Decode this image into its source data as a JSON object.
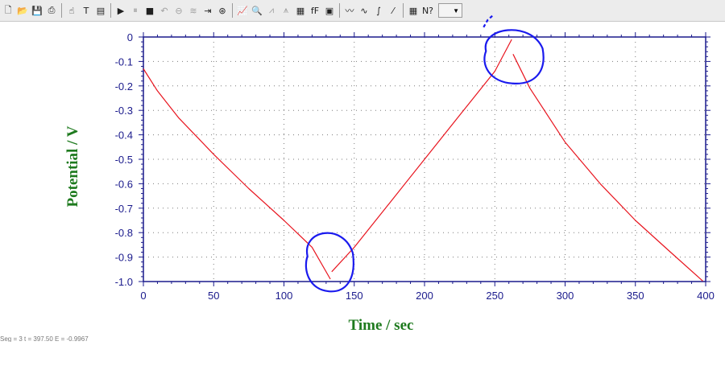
{
  "toolbar": {
    "buttons": [
      {
        "name": "new-file-icon",
        "glyph": "🗋",
        "enabled": true
      },
      {
        "name": "open-folder-icon",
        "glyph": "📂",
        "enabled": true
      },
      {
        "name": "save-icon",
        "glyph": "💾",
        "enabled": true
      },
      {
        "name": "print-icon",
        "glyph": "⎙",
        "enabled": true
      },
      {
        "name": "sep"
      },
      {
        "name": "hand-tool-icon",
        "glyph": "☝",
        "enabled": true
      },
      {
        "name": "text-tool-icon",
        "glyph": "T",
        "enabled": true
      },
      {
        "name": "data-list-icon",
        "glyph": "▤",
        "enabled": true
      },
      {
        "name": "sep"
      },
      {
        "name": "run-icon",
        "glyph": "▶",
        "enabled": true
      },
      {
        "name": "pause-icon",
        "glyph": "⏸",
        "enabled": false
      },
      {
        "name": "stop-icon",
        "glyph": "■",
        "enabled": true
      },
      {
        "name": "reverse-icon",
        "glyph": "↶",
        "enabled": false
      },
      {
        "name": "ir-comp-icon",
        "glyph": "⊖",
        "enabled": false
      },
      {
        "name": "filter-icon",
        "glyph": "≋",
        "enabled": false
      },
      {
        "name": "cell-control-icon",
        "glyph": "⇥",
        "enabled": true
      },
      {
        "name": "rotation-icon",
        "glyph": "⊛",
        "enabled": true
      },
      {
        "name": "sep"
      },
      {
        "name": "graph-options-icon",
        "glyph": "📈",
        "enabled": true
      },
      {
        "name": "zoom-icon",
        "glyph": "🔍",
        "enabled": false
      },
      {
        "name": "peak-icon",
        "glyph": "⩘",
        "enabled": false
      },
      {
        "name": "baseline-icon",
        "glyph": "⩚",
        "enabled": false
      },
      {
        "name": "color-icon",
        "glyph": "▦",
        "enabled": true
      },
      {
        "name": "font-icon",
        "glyph": "fF",
        "enabled": true
      },
      {
        "name": "copy-graph-icon",
        "glyph": "▣",
        "enabled": true
      },
      {
        "name": "sep"
      },
      {
        "name": "smooth-icon",
        "glyph": "〰",
        "enabled": true
      },
      {
        "name": "derivative-icon",
        "glyph": "∿",
        "enabled": true
      },
      {
        "name": "integrate-icon",
        "glyph": "∫",
        "enabled": true
      },
      {
        "name": "semi-integral-icon",
        "glyph": "⁄",
        "enabled": true
      },
      {
        "name": "sep"
      },
      {
        "name": "calculator-icon",
        "glyph": "▦",
        "enabled": true
      },
      {
        "name": "help-icon",
        "glyph": "N?",
        "enabled": true
      },
      {
        "name": "combo"
      }
    ],
    "combo_value": ""
  },
  "chart_data": {
    "type": "line",
    "xlabel": "Time / sec",
    "ylabel": "Potential / V",
    "xlim": [
      0,
      400
    ],
    "ylim": [
      -1.0,
      0
    ],
    "xticks": [
      0,
      50,
      100,
      150,
      200,
      250,
      300,
      350,
      400
    ],
    "yticks": [
      0,
      -0.1,
      -0.2,
      -0.3,
      -0.4,
      -0.5,
      -0.6,
      -0.7,
      -0.8,
      -0.9,
      -1.0
    ],
    "ytick_labels": [
      "0",
      "-0.1",
      "-0.2",
      "-0.3",
      "-0.4",
      "-0.5",
      "-0.6",
      "-0.7",
      "-0.8",
      "-0.9",
      "-1.0"
    ],
    "grid": true,
    "series": [
      {
        "color": "#e8141e",
        "segments": [
          [
            [
              0,
              -0.13
            ],
            [
              10,
              -0.22
            ],
            [
              25,
              -0.33
            ],
            [
              50,
              -0.48
            ],
            [
              75,
              -0.62
            ],
            [
              100,
              -0.75
            ],
            [
              120,
              -0.86
            ],
            [
              133,
              -0.99
            ]
          ],
          [
            [
              134,
              -0.96
            ],
            [
              150,
              -0.86
            ],
            [
              175,
              -0.68
            ],
            [
              200,
              -0.5
            ],
            [
              225,
              -0.32
            ],
            [
              250,
              -0.14
            ],
            [
              262,
              -0.01
            ]
          ],
          [
            [
              263,
              -0.07
            ],
            [
              275,
              -0.21
            ],
            [
              300,
              -0.43
            ],
            [
              325,
              -0.6
            ],
            [
              350,
              -0.75
            ],
            [
              375,
              -0.88
            ],
            [
              398,
              -0.998
            ]
          ]
        ]
      }
    ],
    "annotations": [
      {
        "type": "ellipse",
        "color": "#1a1aee",
        "cx": 132,
        "cy": -0.92,
        "rx": 17,
        "ry": 0.12
      },
      {
        "type": "ellipse",
        "color": "#1a1aee",
        "cx": 263,
        "cy": -0.08,
        "rx": 21,
        "ry": 0.11
      },
      {
        "type": "dash",
        "color": "#1a1aee",
        "points": [
          [
            242,
            0.04
          ],
          [
            245,
            0.07
          ],
          [
            249,
            0.09
          ]
        ]
      }
    ]
  },
  "status": {
    "text": "Seg = 3   t = 397.50   E = -0.9967"
  }
}
